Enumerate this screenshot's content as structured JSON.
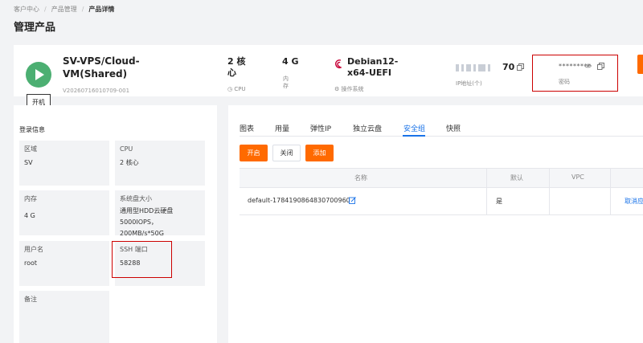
{
  "breadcrumb": [
    "客户中心",
    "产品管理",
    "产品详情"
  ],
  "breadcrumb_sep": "/",
  "page_title": "管理产品",
  "product": {
    "name": "SV-VPS/Cloud-VM(Shared)",
    "id": "V20260716010709-001",
    "power_tooltip": "开机",
    "cpu_value": "2 核心",
    "cpu_label": "CPU",
    "mem_value": "4 G",
    "mem_label": "内存",
    "os_value": "Debian12-x64-UEFI",
    "os_label": "操作系统",
    "ip_suffix": "70",
    "ip_label": "IP地址(个)",
    "password_mask": "*********",
    "password_label": "密码"
  },
  "login_info": {
    "title": "登录信息",
    "cells": [
      {
        "key": "区域",
        "value": "SV"
      },
      {
        "key": "CPU",
        "value": "2 核心"
      },
      {
        "key": "内存",
        "value": "4 G"
      },
      {
        "key": "系统盘大小",
        "value": "通用型HDD云硬盘 5000IOPS，200MB/s*50G"
      },
      {
        "key": "用户名",
        "value": "root"
      },
      {
        "key": "SSH 端口",
        "value": "58288"
      },
      {
        "key": "备注",
        "value": ""
      }
    ]
  },
  "tabs": [
    "图表",
    "用量",
    "弹性IP",
    "独立云盘",
    "安全组",
    "快照"
  ],
  "active_tab": "安全组",
  "actions": {
    "enable": "开启",
    "close": "关闭",
    "add": "添加"
  },
  "table": {
    "headers": [
      "名称",
      "默认",
      "VPC"
    ],
    "rows": [
      {
        "name": "default-1784190864830700960",
        "default": "是",
        "vpc": "",
        "action": "取消应"
      }
    ]
  },
  "colors": {
    "accent": "#ff6a00",
    "play": "#4caf72",
    "link": "#1a73e8",
    "highlight": "#cc0000"
  }
}
